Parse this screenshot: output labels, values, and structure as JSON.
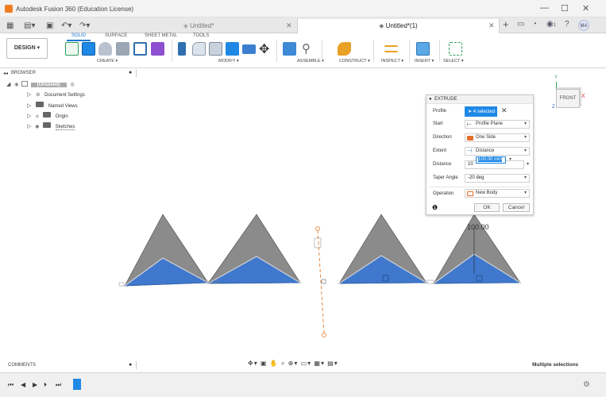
{
  "window": {
    "title": "Autodesk Fusion 360 (Education License)",
    "min": "—",
    "max": "☐",
    "close": "✕"
  },
  "tabs": [
    {
      "label": "Untitled*",
      "active": false
    },
    {
      "label": "Untitled*(1)",
      "active": true
    }
  ],
  "header": {
    "avatar": "MA",
    "notification_count": "1"
  },
  "toolbar": {
    "design_label": "DESIGN ▾",
    "workspace_tabs": [
      "SOLID",
      "SURFACE",
      "SHEET METAL",
      "TOOLS"
    ],
    "groups": [
      "CREATE ▾",
      "MODIFY ▾",
      "ASSEMBLE ▾",
      "CONSTRUCT ▾",
      "INSPECT ▾",
      "INSERT ▾",
      "SELECT ▾"
    ]
  },
  "browser": {
    "title": "BROWSER",
    "root": "(Unsaved)",
    "items": [
      "Document Settings",
      "Named Views",
      "Origin",
      "Sketches"
    ]
  },
  "extrude": {
    "title": "EXTRUDE",
    "rows": [
      {
        "label": "Profile",
        "value": "4 selected"
      },
      {
        "label": "Start",
        "value": "Profile Plane"
      },
      {
        "label": "Direction",
        "value": "One Side"
      },
      {
        "label": "Extent",
        "value": "Distance"
      },
      {
        "label": "Distance",
        "value": "10",
        "input": "100.00 mm"
      },
      {
        "label": "Taper Angle",
        "value": "-20 deg"
      },
      {
        "label": "Operation",
        "value": "New Body"
      }
    ],
    "ok": "OK",
    "cancel": "Cancel"
  },
  "viewcube": {
    "face": "FRONT",
    "x": "X",
    "y": "Y",
    "z": "Z"
  },
  "canvas": {
    "dimension_label": "100.00"
  },
  "bottom": {
    "comments": "COMMENTS",
    "status": "Multiple selections"
  }
}
